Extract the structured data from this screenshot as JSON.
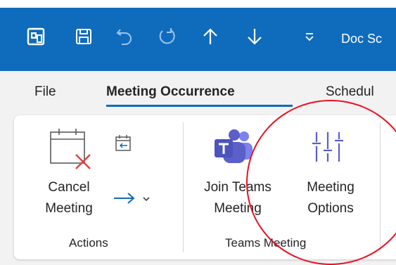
{
  "titlebar": {
    "doc_title": "Doc Sc",
    "icons": [
      "outlook-app-icon",
      "save-icon",
      "undo-icon",
      "redo-icon",
      "up-arrow-icon",
      "down-arrow-icon",
      "customize-toolbar-icon"
    ]
  },
  "tabs": [
    {
      "label": "File"
    },
    {
      "label": "Meeting Occurrence"
    },
    {
      "label": "Schedul"
    }
  ],
  "ribbon": {
    "actions": {
      "cancel_line1": "Cancel",
      "cancel_line2": "Meeting",
      "group_label": "Actions"
    },
    "teams": {
      "join_line1": "Join Teams",
      "join_line2": "Meeting",
      "options_line1": "Meeting",
      "options_line2": "Options",
      "group_label": "Teams Meeting"
    }
  },
  "colors": {
    "accent": "#0f6cbd",
    "annotation": "#e81123",
    "teams": "#5b5fc7"
  }
}
